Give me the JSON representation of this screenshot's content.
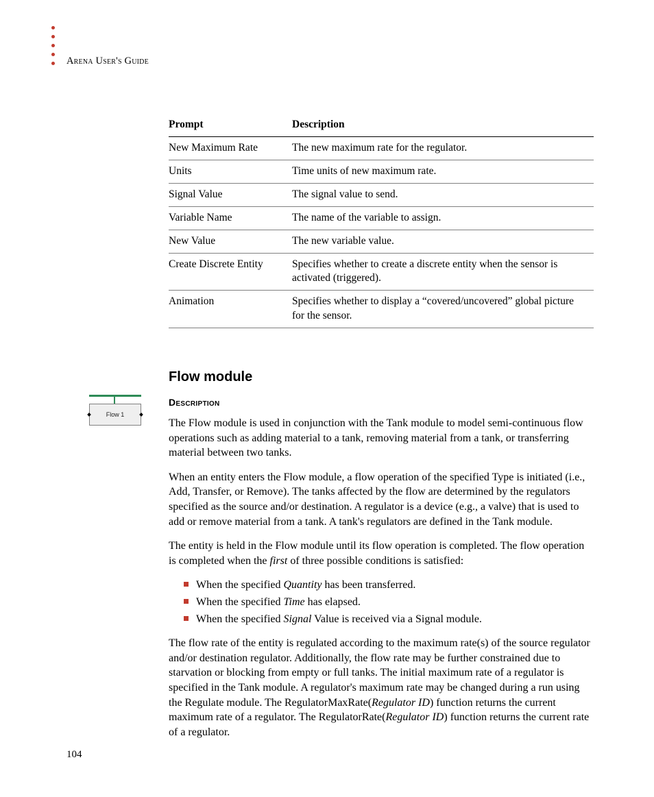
{
  "running_head": "Arena User's Guide",
  "page_number": "104",
  "table": {
    "headers": [
      "Prompt",
      "Description"
    ],
    "rows": [
      {
        "prompt": "New Maximum Rate",
        "desc": "The new maximum rate for the regulator."
      },
      {
        "prompt": "Units",
        "desc": "Time units of new maximum rate."
      },
      {
        "prompt": "Signal Value",
        "desc": "The signal value to send."
      },
      {
        "prompt": "Variable Name",
        "desc": "The name of the variable to assign."
      },
      {
        "prompt": "New Value",
        "desc": "The new variable value."
      },
      {
        "prompt": "Create Discrete Entity",
        "desc": "Specifies whether to create a discrete entity when the sensor is activated (triggered)."
      },
      {
        "prompt": "Animation",
        "desc": "Specifies whether to display a “covered/uncovered” global picture for the sensor."
      }
    ]
  },
  "section": {
    "title": "Flow module",
    "subhead": "Description",
    "module_icon_label": "Flow 1",
    "p1": "The Flow module is used in conjunction with the Tank module to model semi-continuous flow operations such as adding material to a tank, removing material from a tank, or transferring material between two tanks.",
    "p2": "When an entity enters the Flow module, a flow operation of the specified Type is initiated (i.e., Add, Transfer, or Remove). The tanks affected by the flow are determined by the regulators specified as the source and/or destination. A regulator is a device (e.g., a valve) that is used to add or remove material from a tank. A tank's regulators are defined in the Tank module.",
    "p3_a": "The entity is held in the Flow module until its flow operation is completed. The flow operation is completed when the ",
    "p3_ital": "first",
    "p3_b": " of three possible conditions is satisfied:",
    "bullets": [
      {
        "a": "When the specified ",
        "ital": "Quantity",
        "b": " has been transferred."
      },
      {
        "a": "When the specified ",
        "ital": "Time",
        "b": " has elapsed."
      },
      {
        "a": "When the specified ",
        "ital": "Signal",
        "b": " Value is received via a Signal module."
      }
    ],
    "p4_a": "The flow rate of the entity is regulated according to the maximum rate(s) of the source regulator and/or destination regulator. Additionally, the flow rate may be further constrained due to starvation or blocking from empty or full tanks. The initial maximum rate of a regulator is specified in the Tank module. A regulator's maximum rate may be changed during a run using the Regulate module. The RegulatorMaxRate(",
    "p4_ital1": "Regulator ID",
    "p4_b": ") function returns the current maximum rate of a regulator. The RegulatorRate(",
    "p4_ital2": "Regulator ID",
    "p4_c": ") function returns the current rate of a regulator."
  }
}
